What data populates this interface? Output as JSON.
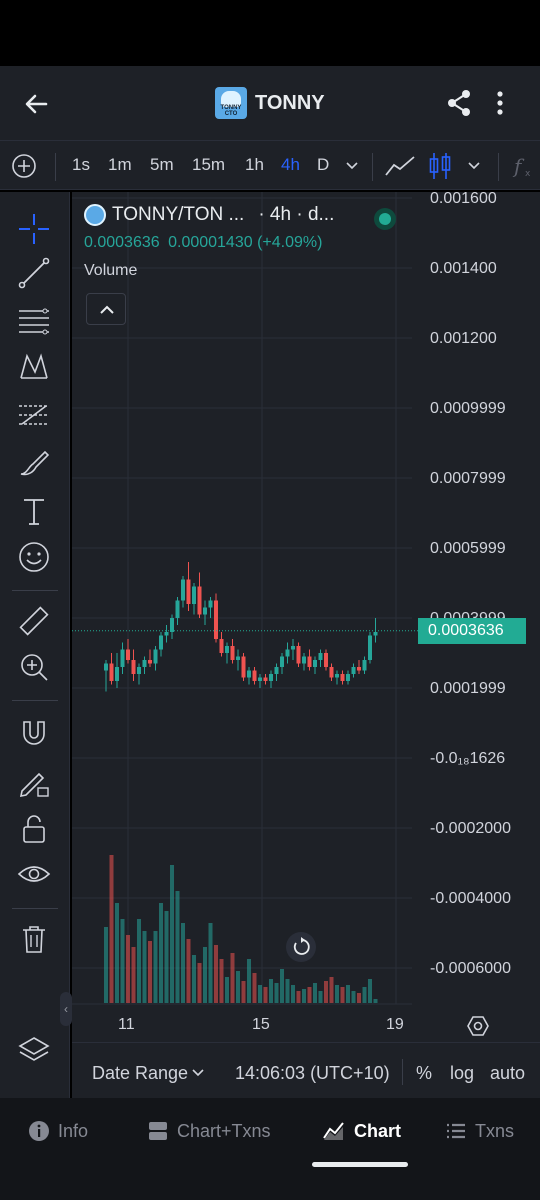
{
  "header": {
    "title": "TONNY",
    "logo_text": "TONNY CTO",
    "icons": [
      "back-arrow-icon",
      "share-icon",
      "more-vert-icon"
    ]
  },
  "toolbar": {
    "intervals": [
      "1s",
      "1m",
      "5m",
      "15m",
      "1h",
      "4h",
      "D"
    ],
    "active_interval": "4h"
  },
  "legend": {
    "symbol": "TONNY/TON ...",
    "meta": "· 4h · d...",
    "price": "0.0003636",
    "change": "0.00001430",
    "change_pct": "(+4.09%)",
    "volume_label": "Volume"
  },
  "price_axis": {
    "labels": [
      "0.001600",
      "0.001400",
      "0.001200",
      "0.0009999",
      "0.0007999",
      "0.0005999",
      "0.0003999",
      "0.0001999",
      "-0.0₁₈1626",
      "-0.0002000",
      "-0.0004000",
      "-0.0006000"
    ],
    "current_price": "0.0003636"
  },
  "time_axis": {
    "labels": [
      "11",
      "15",
      "19"
    ]
  },
  "bottom_bar": {
    "date_range": "Date Range",
    "time": "14:06:03 (UTC+10)",
    "percent": "%",
    "log": "log",
    "auto": "auto"
  },
  "nav": {
    "items": [
      {
        "label": "Info",
        "icon": "info-icon"
      },
      {
        "label": "Chart+Txns",
        "icon": "split-icon"
      },
      {
        "label": "Chart",
        "icon": "chart-icon"
      },
      {
        "label": "Txns",
        "icon": "list-icon"
      }
    ],
    "active": "Chart"
  },
  "colors": {
    "up": "#26a69a",
    "down": "#ef5350",
    "accent": "#2962ff",
    "price_tag": "#22ab94",
    "background": "#1e2127"
  },
  "chart_data": {
    "type": "candlestick",
    "x_ticks": [
      "11",
      "15",
      "19"
    ],
    "y_range": [
      -0.0006,
      0.0016
    ],
    "last_price": 0.0003636,
    "ohlc": [
      [
        0.00025,
        0.00028,
        0.00019,
        0.00027
      ],
      [
        0.00027,
        0.0003,
        0.00021,
        0.00022
      ],
      [
        0.00022,
        0.0003,
        0.0002,
        0.00026
      ],
      [
        0.00026,
        0.00033,
        0.00024,
        0.00031
      ],
      [
        0.00031,
        0.00034,
        0.00027,
        0.00028
      ],
      [
        0.00028,
        0.00031,
        0.00022,
        0.00024
      ],
      [
        0.00024,
        0.00027,
        0.00021,
        0.00026
      ],
      [
        0.00026,
        0.00029,
        0.00024,
        0.00028
      ],
      [
        0.00028,
        0.00031,
        0.00026,
        0.00027
      ],
      [
        0.00027,
        0.00032,
        0.00025,
        0.00031
      ],
      [
        0.00031,
        0.00036,
        0.00029,
        0.00035
      ],
      [
        0.00035,
        0.00038,
        0.00033,
        0.00036
      ],
      [
        0.00036,
        0.00041,
        0.00034,
        0.0004
      ],
      [
        0.0004,
        0.00046,
        0.00038,
        0.00045
      ],
      [
        0.00045,
        0.00052,
        0.00043,
        0.00051
      ],
      [
        0.00051,
        0.00056,
        0.00042,
        0.00044
      ],
      [
        0.00044,
        0.0005,
        0.00041,
        0.00049
      ],
      [
        0.00049,
        0.00053,
        0.0004,
        0.00041
      ],
      [
        0.00041,
        0.00045,
        0.00038,
        0.00043
      ],
      [
        0.00043,
        0.00046,
        0.0004,
        0.00045
      ],
      [
        0.00045,
        0.00047,
        0.00033,
        0.00034
      ],
      [
        0.00034,
        0.00036,
        0.00029,
        0.0003
      ],
      [
        0.0003,
        0.00033,
        0.00027,
        0.00032
      ],
      [
        0.00032,
        0.00034,
        0.00027,
        0.00028
      ],
      [
        0.00028,
        0.00031,
        0.00025,
        0.00029
      ],
      [
        0.00029,
        0.0003,
        0.00022,
        0.00023
      ],
      [
        0.00023,
        0.00026,
        0.00021,
        0.00025
      ],
      [
        0.00025,
        0.00026,
        0.00021,
        0.00022
      ],
      [
        0.00022,
        0.00024,
        0.0002,
        0.00023
      ],
      [
        0.00023,
        0.00024,
        0.00021,
        0.00022
      ],
      [
        0.00022,
        0.00025,
        0.0002,
        0.00024
      ],
      [
        0.00024,
        0.00027,
        0.00022,
        0.00026
      ],
      [
        0.00026,
        0.0003,
        0.00024,
        0.00029
      ],
      [
        0.00029,
        0.00033,
        0.00027,
        0.00031
      ],
      [
        0.00031,
        0.00034,
        0.00028,
        0.00032
      ],
      [
        0.00032,
        0.00033,
        0.00026,
        0.00027
      ],
      [
        0.00027,
        0.0003,
        0.00025,
        0.00029
      ],
      [
        0.00029,
        0.00031,
        0.00025,
        0.00026
      ],
      [
        0.00026,
        0.00029,
        0.00024,
        0.00028
      ],
      [
        0.00028,
        0.00031,
        0.00026,
        0.0003
      ],
      [
        0.0003,
        0.00031,
        0.00025,
        0.00026
      ],
      [
        0.00026,
        0.00027,
        0.00022,
        0.00023
      ],
      [
        0.00023,
        0.00025,
        0.00021,
        0.00024
      ],
      [
        0.00024,
        0.00025,
        0.00021,
        0.00022
      ],
      [
        0.00022,
        0.00025,
        0.00021,
        0.00024
      ],
      [
        0.00024,
        0.00027,
        0.00023,
        0.00026
      ],
      [
        0.00026,
        0.00028,
        0.00024,
        0.00025
      ],
      [
        0.00025,
        0.00029,
        0.00024,
        0.00028
      ],
      [
        0.00028,
        0.00036,
        0.00027,
        0.00035
      ],
      [
        0.00035,
        0.0004,
        0.00033,
        0.00036
      ]
    ],
    "volume_scale_max": 1.0,
    "volume": [
      0.38,
      0.74,
      0.5,
      0.42,
      0.34,
      0.28,
      0.42,
      0.36,
      0.31,
      0.36,
      0.5,
      0.46,
      0.69,
      0.56,
      0.4,
      0.32,
      0.24,
      0.2,
      0.28,
      0.4,
      0.29,
      0.22,
      0.13,
      0.25,
      0.16,
      0.11,
      0.22,
      0.15,
      0.09,
      0.08,
      0.12,
      0.1,
      0.17,
      0.12,
      0.09,
      0.06,
      0.07,
      0.08,
      0.1,
      0.06,
      0.11,
      0.13,
      0.09,
      0.08,
      0.09,
      0.06,
      0.05,
      0.08,
      0.12,
      0.02
    ]
  }
}
